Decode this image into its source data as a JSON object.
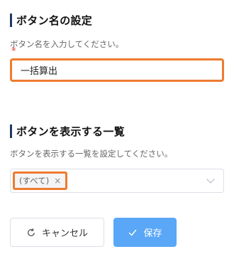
{
  "section_button_name": {
    "title": "ボタン名の設定",
    "description": "ボタン名を入力してください。",
    "required_mark": "*",
    "input_value": "一括算出"
  },
  "section_list": {
    "title": "ボタンを表示する一覧",
    "description": "ボタンを表示する一覧を設定してください。",
    "selected_chip": "(すべて)",
    "chip_close": "×",
    "dropdown_icon": "chevron-down-icon"
  },
  "actions": {
    "cancel_label": "キャンセル",
    "cancel_icon": "refresh-icon",
    "save_label": "保存",
    "save_icon": "check-icon"
  },
  "colors": {
    "accent_bar": "#1f3a5f",
    "highlight_border": "#ee7b2f",
    "required": "#e53935",
    "primary_button": "#5aa7f7"
  }
}
